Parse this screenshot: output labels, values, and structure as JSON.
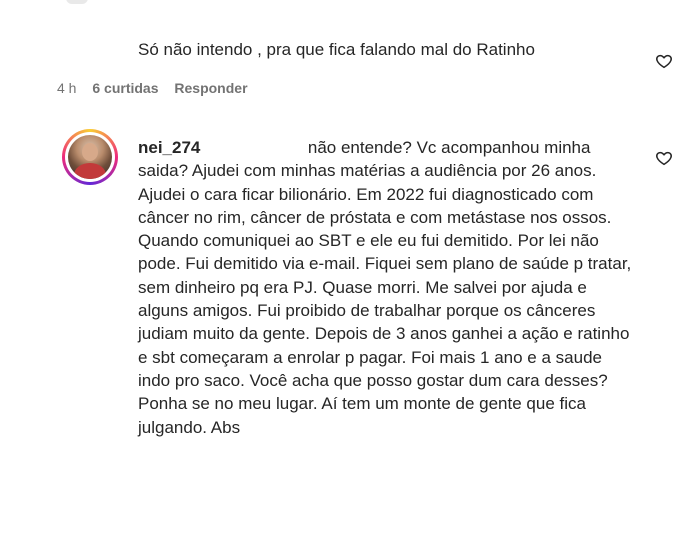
{
  "previous_reply": {
    "text": "Só não intendo , pra que fica falando mal do Ratinho",
    "time": "4 h",
    "likes": "6 curtidas",
    "reply_label": "Responder"
  },
  "comment": {
    "username": "nei_274",
    "text": "não entende? Vc acompanhou minha saida? Ajudei com minhas matérias a audiência por 26 anos. Ajudei o cara ficar bilionário. Em 2022 fui diagnosticado com câncer no rim, câncer de próstata e com metástase nos ossos. Quando comuniquei ao SBT e ele eu fui demitido. Por lei não pode. Fui demitido via e-mail. Fiquei sem plano de saúde p tratar, sem dinheiro pq era PJ. Quase morri. Me salvei por ajuda e alguns amigos. Fui proibido de trabalhar porque os cânceres judiam muito da gente. Depois de 3 anos ganhei a ação e ratinho e sbt começaram a enrolar p pagar. Foi mais 1 ano e a saude indo pro saco. Você acha que posso gostar dum cara desses? Ponha se no meu lugar. Aí tem um monte de gente que fica julgando. Abs"
  },
  "icons": {
    "like": "heart-outline-icon",
    "avatar": "user-avatar"
  },
  "colors": {
    "text": "#262626",
    "meta": "#737373",
    "background": "#ffffff"
  }
}
